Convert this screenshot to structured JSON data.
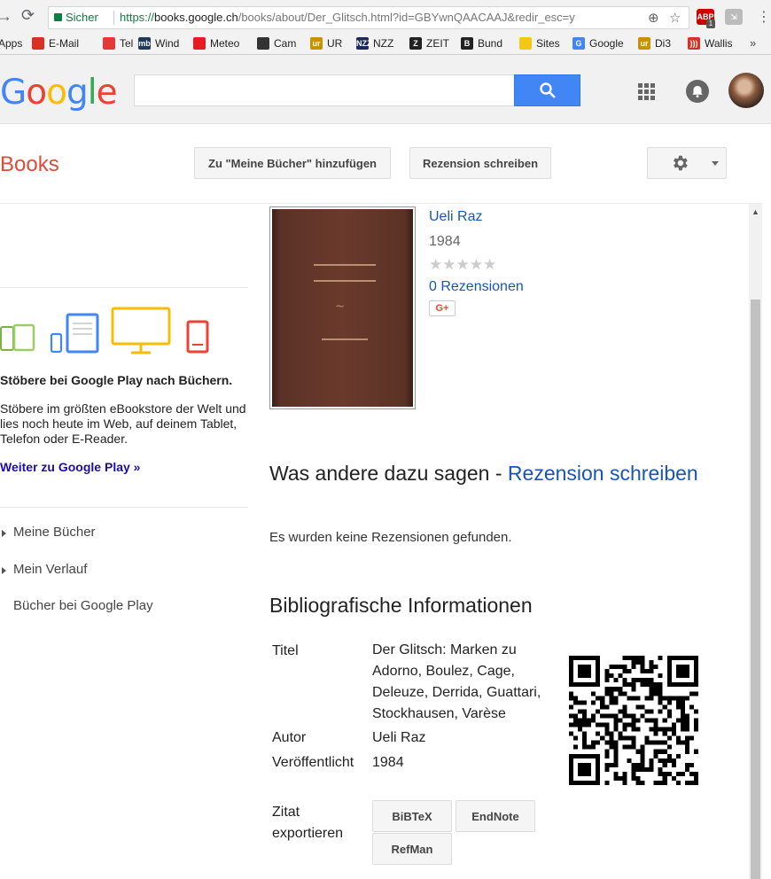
{
  "browser": {
    "secure_label": "Sicher",
    "url_protocol": "https://",
    "url_host": "books.google.ch",
    "url_path": "/books/about/Der_Glitsch.html?id=GBYwnQAACAAJ&redir_esc=y",
    "extension_badge": "1"
  },
  "bookmarks": [
    {
      "label": "Apps",
      "icon": "apps-icon",
      "color": "#4285f4"
    },
    {
      "label": "E-Mail",
      "icon": "mail-icon",
      "color": "#d93025"
    },
    {
      "label": "Tel",
      "icon": "phone-icon",
      "color": "#e53935"
    },
    {
      "label": "Wind",
      "icon": "mb-icon",
      "mark": "mb",
      "color": "#1e3a5f"
    },
    {
      "label": "Meteo",
      "icon": "swiss-cross-icon",
      "color": "#e41e20"
    },
    {
      "label": "Cam",
      "icon": "camera-icon",
      "color": "#333333"
    },
    {
      "label": "UR",
      "icon": "ur-icon",
      "mark": "ur",
      "color": "#c79100"
    },
    {
      "label": "NZZ",
      "icon": "nzz-icon",
      "mark": "NZZ",
      "color": "#1c2a57"
    },
    {
      "label": "ZEIT",
      "icon": "zeit-icon",
      "mark": "Z",
      "color": "#222222"
    },
    {
      "label": "Bund",
      "icon": "bund-icon",
      "mark": "B",
      "color": "#222222"
    },
    {
      "label": "Sites",
      "icon": "folder-icon",
      "color": "#f5c518"
    },
    {
      "label": "Google",
      "icon": "google-g-icon",
      "mark": "G",
      "color": "#4285f4"
    },
    {
      "label": "Di3",
      "icon": "ur-icon",
      "mark": "ur",
      "color": "#c79100"
    },
    {
      "label": "Wallis",
      "icon": "wallis-icon",
      "mark": ")))",
      "color": "#d93025"
    }
  ],
  "header": {
    "logo": "Google",
    "logo_colors": [
      "#4285f4",
      "#ea4335",
      "#fbbc05",
      "#4285f4",
      "#34a853",
      "#ea4335"
    ],
    "search_value": ""
  },
  "books": {
    "title": "Books",
    "add_button": "Zu \"Meine Bücher\" hinzufügen",
    "review_button": "Rezension schreiben"
  },
  "sidebar": {
    "promo_title": "Stöbere bei Google Play nach Büchern.",
    "promo_text_1": "Stöbere im größten eBookstore der Welt und",
    "promo_text_2": "lies noch heute im Web, auf deinem Tablet,",
    "promo_text_3": "Telefon oder E-Reader.",
    "promo_link": "Weiter zu Google Play »",
    "nav_my_books": "Meine Bücher",
    "nav_history": "Mein Verlauf",
    "nav_play": "Bücher bei Google Play"
  },
  "book": {
    "author": "Ueli Raz",
    "year": "1984",
    "stars": "★★★★★",
    "rating": 0,
    "reviews": "0 Rezensionen",
    "gplus": "G+"
  },
  "reviews": {
    "heading_prefix": "Was andere dazu sagen - ",
    "heading_link": "Rezension schreiben",
    "empty": "Es wurden keine Rezensionen gefunden."
  },
  "bib": {
    "heading": "Bibliografische Informationen",
    "title_label": "Titel",
    "title_lines": [
      "Der Glitsch: Marken zu",
      "Adorno, Boulez, Cage,",
      "Deleuze, Derrida, Guattari,",
      "Stockhausen, Varèse"
    ],
    "author_label": "Autor",
    "author_value": "Ueli Raz",
    "published_label": "Veröffentlicht",
    "published_value": "1984",
    "export_label_1": "Zitat",
    "export_label_2": "exportieren",
    "buttons": [
      "BiBTeX",
      "EndNote",
      "RefMan"
    ]
  }
}
